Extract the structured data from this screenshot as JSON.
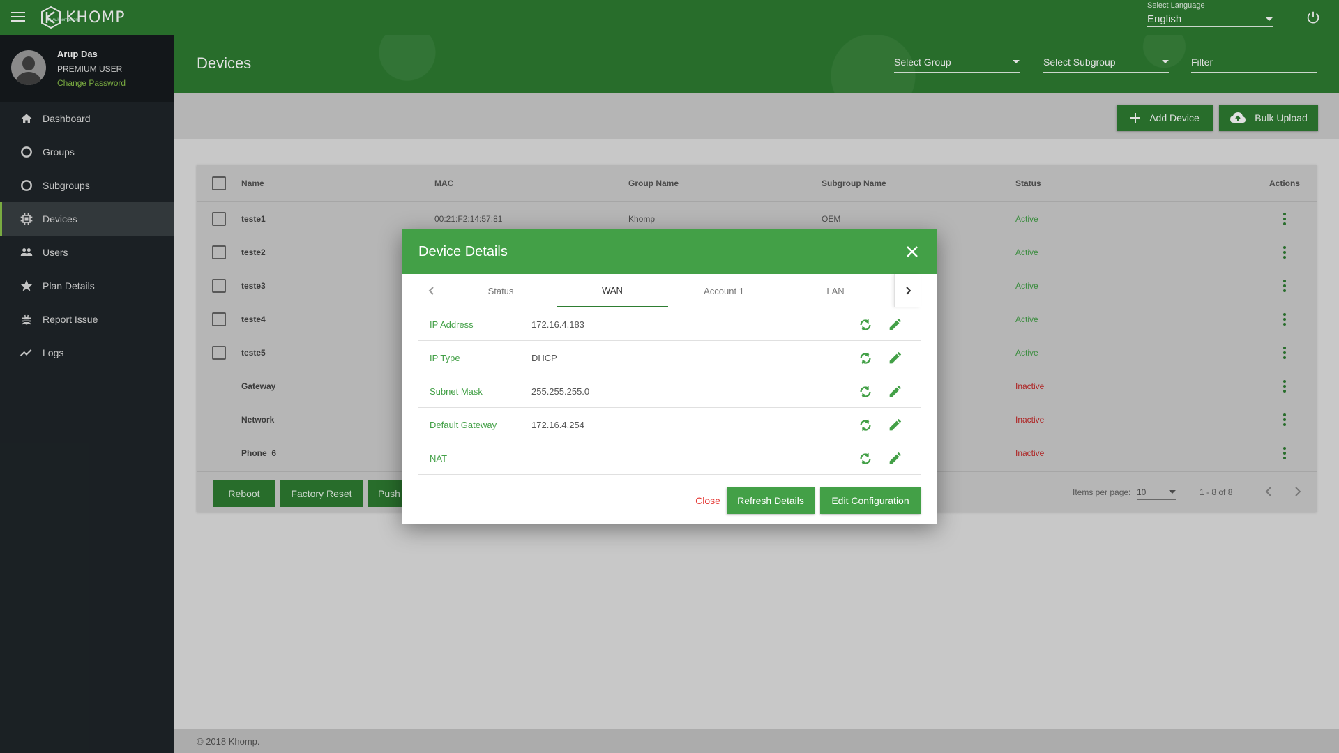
{
  "app": {
    "logo_text": "KHOMP",
    "logo_sub": "www.khomp.com",
    "language_label": "Select Language",
    "language_value": "English"
  },
  "profile": {
    "name": "Arup Das",
    "type": "PREMIUM USER",
    "change_password": "Change Password"
  },
  "sidebar": {
    "items": [
      {
        "label": "Dashboard",
        "icon": "home-icon"
      },
      {
        "label": "Groups",
        "icon": "circle-icon"
      },
      {
        "label": "Subgroups",
        "icon": "circle-icon"
      },
      {
        "label": "Devices",
        "icon": "chip-icon"
      },
      {
        "label": "Users",
        "icon": "users-icon"
      },
      {
        "label": "Plan Details",
        "icon": "star-icon"
      },
      {
        "label": "Report Issue",
        "icon": "bug-icon"
      },
      {
        "label": "Logs",
        "icon": "trend-icon"
      }
    ]
  },
  "header": {
    "title": "Devices",
    "select_group": "Select Group",
    "select_subgroup": "Select Subgroup",
    "filter_placeholder": "Filter"
  },
  "toolbar": {
    "add_device": "Add Device",
    "bulk_upload": "Bulk Upload"
  },
  "table": {
    "headers": {
      "name": "Name",
      "mac": "MAC",
      "group": "Group Name",
      "subgroup": "Subgroup Name",
      "status": "Status",
      "actions": "Actions"
    },
    "rows": [
      {
        "name": "teste1",
        "mac": "00:21:F2:14:57:81",
        "group": "Khomp",
        "subgroup": "OEM",
        "status": "Active",
        "checkbox": true
      },
      {
        "name": "teste2",
        "mac": "",
        "group": "",
        "subgroup": "",
        "status": "Active",
        "checkbox": true
      },
      {
        "name": "teste3",
        "mac": "",
        "group": "",
        "subgroup": "",
        "status": "Active",
        "checkbox": true
      },
      {
        "name": "teste4",
        "mac": "",
        "group": "",
        "subgroup": "",
        "status": "Active",
        "checkbox": true
      },
      {
        "name": "teste5",
        "mac": "",
        "group": "",
        "subgroup": "",
        "status": "Active",
        "checkbox": true
      },
      {
        "name": "Gateway",
        "mac": "",
        "group": "",
        "subgroup": "",
        "status": "Inactive",
        "checkbox": false
      },
      {
        "name": "Network",
        "mac": "",
        "group": "",
        "subgroup": "",
        "status": "Inactive",
        "checkbox": false
      },
      {
        "name": "Phone_6",
        "mac": "",
        "group": "",
        "subgroup": "",
        "status": "Inactive",
        "checkbox": false
      }
    ],
    "footer": {
      "reboot": "Reboot",
      "factory_reset": "Factory Reset",
      "push": "Push",
      "items_per_page_label": "Items per page:",
      "items_per_page": "10",
      "range": "1 - 8 of 8"
    }
  },
  "footer": {
    "copyright": "© 2018 Khomp."
  },
  "modal": {
    "title": "Device Details",
    "tabs": [
      "Status",
      "WAN",
      "Account 1",
      "LAN"
    ],
    "selected_tab": "WAN",
    "rows": [
      {
        "label": "IP Address",
        "value": "172.16.4.183"
      },
      {
        "label": "IP Type",
        "value": "DHCP"
      },
      {
        "label": "Subnet Mask",
        "value": "255.255.255.0"
      },
      {
        "label": "Default Gateway",
        "value": "172.16.4.254"
      },
      {
        "label": "NAT",
        "value": ""
      }
    ],
    "close": "Close",
    "refresh": "Refresh Details",
    "edit": "Edit Configuration"
  },
  "colors": {
    "brand": "#2e7d32",
    "accent": "#43a047",
    "active": "#43a047",
    "inactive": "#c62828"
  }
}
